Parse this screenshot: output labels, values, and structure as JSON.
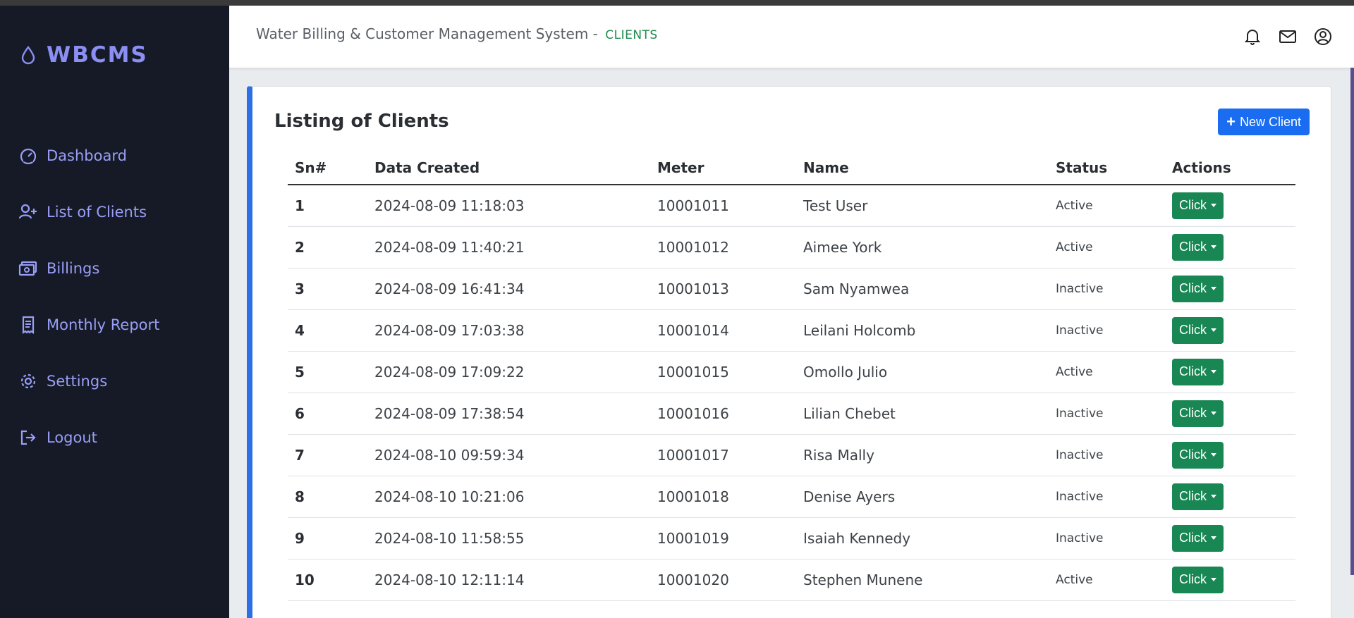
{
  "brand": {
    "name": "WBCMS"
  },
  "sidebar": {
    "items": [
      {
        "label": "Dashboard",
        "icon": "gauge-icon"
      },
      {
        "label": "List of Clients",
        "icon": "users-add-icon"
      },
      {
        "label": "Billings",
        "icon": "money-icon"
      },
      {
        "label": "Monthly Report",
        "icon": "receipt-icon"
      },
      {
        "label": "Settings",
        "icon": "gear-icon"
      },
      {
        "label": "Logout",
        "icon": "logout-icon"
      }
    ]
  },
  "header": {
    "title": "Water Billing & Customer Management System -",
    "section": "CLIENTS",
    "icons": [
      "bell-icon",
      "mail-icon",
      "user-circle-icon"
    ]
  },
  "card": {
    "title": "Listing of Clients",
    "new_button": "New Client"
  },
  "table": {
    "columns": [
      "Sn#",
      "Data Created",
      "Meter",
      "Name",
      "Status",
      "Actions"
    ],
    "action_label": "Click",
    "rows": [
      {
        "sn": "1",
        "created": "2024-08-09 11:18:03",
        "meter": "10001011",
        "name": "Test User",
        "status": "Active"
      },
      {
        "sn": "2",
        "created": "2024-08-09 11:40:21",
        "meter": "10001012",
        "name": "Aimee York",
        "status": "Active"
      },
      {
        "sn": "3",
        "created": "2024-08-09 16:41:34",
        "meter": "10001013",
        "name": "Sam Nyamwea",
        "status": "Inactive"
      },
      {
        "sn": "4",
        "created": "2024-08-09 17:03:38",
        "meter": "10001014",
        "name": "Leilani Holcomb",
        "status": "Inactive"
      },
      {
        "sn": "5",
        "created": "2024-08-09 17:09:22",
        "meter": "10001015",
        "name": "Omollo Julio",
        "status": "Active"
      },
      {
        "sn": "6",
        "created": "2024-08-09 17:38:54",
        "meter": "10001016",
        "name": "Lilian Chebet",
        "status": "Inactive"
      },
      {
        "sn": "7",
        "created": "2024-08-10 09:59:34",
        "meter": "10001017",
        "name": "Risa Mally",
        "status": "Inactive"
      },
      {
        "sn": "8",
        "created": "2024-08-10 10:21:06",
        "meter": "10001018",
        "name": "Denise Ayers",
        "status": "Inactive"
      },
      {
        "sn": "9",
        "created": "2024-08-10 11:58:55",
        "meter": "10001019",
        "name": "Isaiah Kennedy",
        "status": "Inactive"
      },
      {
        "sn": "10",
        "created": "2024-08-10 12:11:14",
        "meter": "10001020",
        "name": "Stephen Munene",
        "status": "Active"
      }
    ]
  },
  "colors": {
    "sidebar_bg": "#151a26",
    "brand": "#8b8ff4",
    "primary": "#1a6df0",
    "success": "#198754",
    "crumb": "#1e8a4c"
  }
}
